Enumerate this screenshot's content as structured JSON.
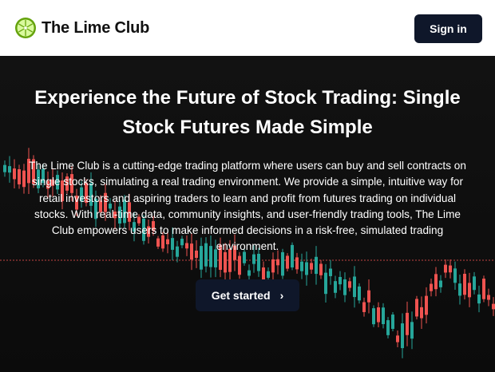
{
  "header": {
    "brand_name": "The Lime Club",
    "logo_icon": "lime-slice-icon",
    "signin_label": "Sign in"
  },
  "hero": {
    "headline": "Experience the Future of Stock Trading: Single Stock Futures Made Simple",
    "description": "The Lime Club is a cutting-edge trading platform where users can buy and sell contracts on single stocks, simulating a real trading environment. We provide a simple, intuitive way for retail investors and aspiring traders to learn and profit from futures trading on individual stocks. With real-time data, community insights, and user-friendly trading tools, The Lime Club empowers users to make informed decisions in a risk-free, simulated trading environment.",
    "cta_label": "Get started",
    "cta_icon": "chevron-right-icon"
  },
  "background_chart": {
    "type": "candlestick",
    "colors": {
      "up": "#26a69a",
      "down": "#ef5350",
      "reference_line": "#ef5350"
    }
  },
  "theme": {
    "header_bg": "#ffffff",
    "hero_bg": "#0d0d0d",
    "button_bg": "#0f172a",
    "lime_green": "#84cc16"
  }
}
